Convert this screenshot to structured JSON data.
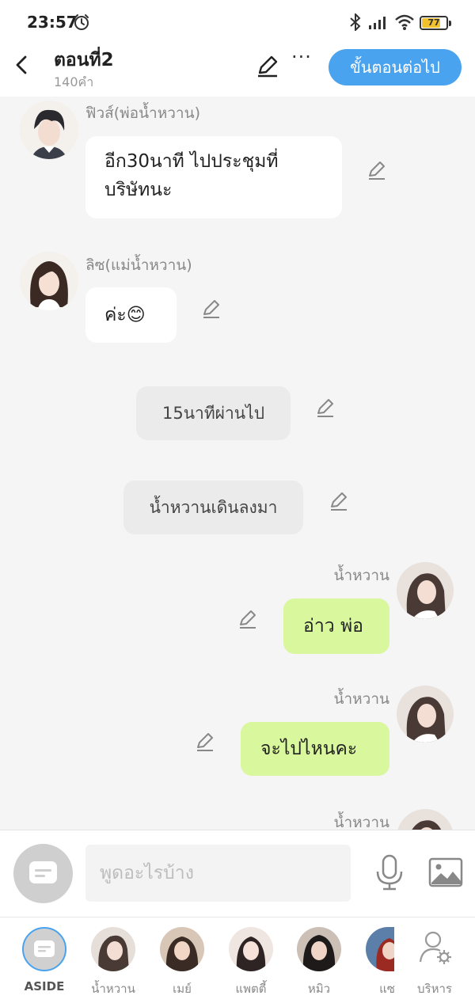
{
  "status_bar": {
    "time": "23:57",
    "battery": "77",
    "battery_level_pct": 77
  },
  "header": {
    "title": "ตอนที่2",
    "subtitle": "140คำ",
    "next_button": "ขั้นตอนต่อไป",
    "more": "···"
  },
  "messages": [
    {
      "kind": "left",
      "sender": "ฟิวส์(พ่อน้ำหวาน)",
      "lines": [
        "อีก30นาที ไปประชุมที่",
        "บริษัทนะ"
      ]
    },
    {
      "kind": "left",
      "sender": "ลิซ(แม่น้ำหวาน)",
      "text": "ค่ะ😊"
    },
    {
      "kind": "narration",
      "text": "15นาทีผ่านไป"
    },
    {
      "kind": "narration",
      "text": "น้ำหวานเดินลงมา"
    },
    {
      "kind": "right",
      "sender": "น้ำหวาน",
      "text": "อ่าว พ่อ"
    },
    {
      "kind": "right",
      "sender": "น้ำหวาน",
      "text": "จะไปไหนคะ"
    },
    {
      "kind": "right",
      "sender": "น้ำหวาน",
      "text": ""
    }
  ],
  "composer": {
    "placeholder": "พูดอะไรบ้าง"
  },
  "tabs": [
    {
      "label": "ASIDE"
    },
    {
      "label": "น้ำหวาน"
    },
    {
      "label": "เมย์"
    },
    {
      "label": "แพตตี้"
    },
    {
      "label": "หมิว"
    },
    {
      "label": "แซ"
    },
    {
      "label": "บริหาร"
    }
  ],
  "colors": {
    "accent": "#4aa3ee",
    "right_bubble": "#d9f79c",
    "left_bubble": "#ffffff",
    "narration_bubble": "#ebebeb",
    "background": "#f5f5f5"
  },
  "icons": [
    "back-arrow-icon",
    "pencil-icon",
    "more-icon",
    "alarm-icon",
    "bluetooth-icon",
    "signal-icon",
    "wifi-icon",
    "battery-icon",
    "mic-icon",
    "image-icon",
    "aside-chat-icon",
    "manage-person-gear-icon"
  ]
}
